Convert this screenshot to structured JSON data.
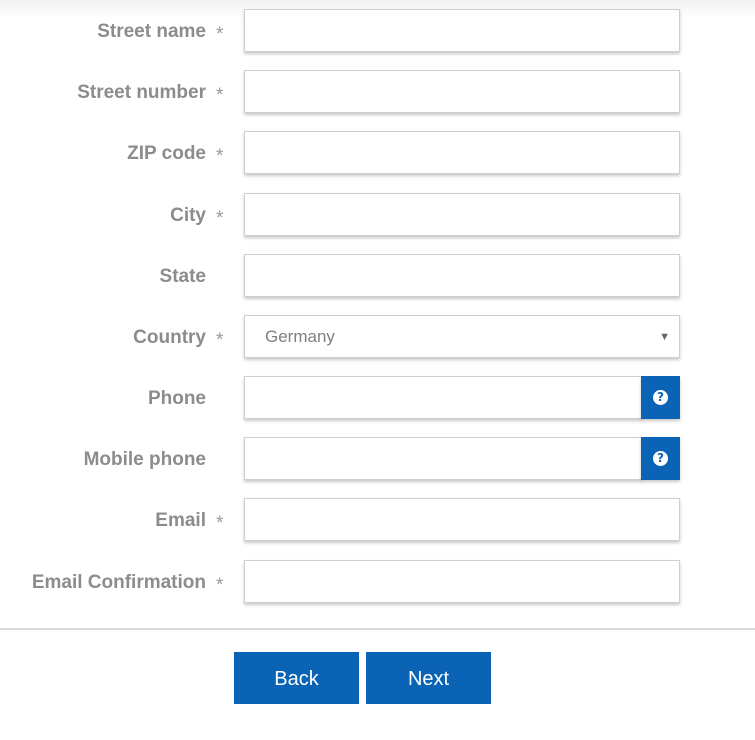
{
  "form": {
    "required_marker": "*",
    "fields": [
      {
        "label": "Street name",
        "required": true,
        "value": ""
      },
      {
        "label": "Street number",
        "required": true,
        "value": ""
      },
      {
        "label": "ZIP code",
        "required": true,
        "value": ""
      },
      {
        "label": "City",
        "required": true,
        "value": ""
      },
      {
        "label": "State",
        "required": false,
        "value": ""
      },
      {
        "label": "Country",
        "required": true,
        "value": "Germany",
        "type": "select"
      },
      {
        "label": "Phone",
        "required": false,
        "value": "",
        "help_icon": "question-circle-icon"
      },
      {
        "label": "Mobile phone",
        "required": false,
        "value": "",
        "help_icon": "question-circle-icon"
      },
      {
        "label": "Email",
        "required": true,
        "value": ""
      },
      {
        "label": "Email Confirmation",
        "required": true,
        "value": ""
      }
    ],
    "help_glyph": "?"
  },
  "actions": {
    "back_label": "Back",
    "next_label": "Next"
  },
  "colors": {
    "accent": "#0a63b5",
    "label": "#8c8c8c",
    "field_border": "#cfcfcf"
  }
}
